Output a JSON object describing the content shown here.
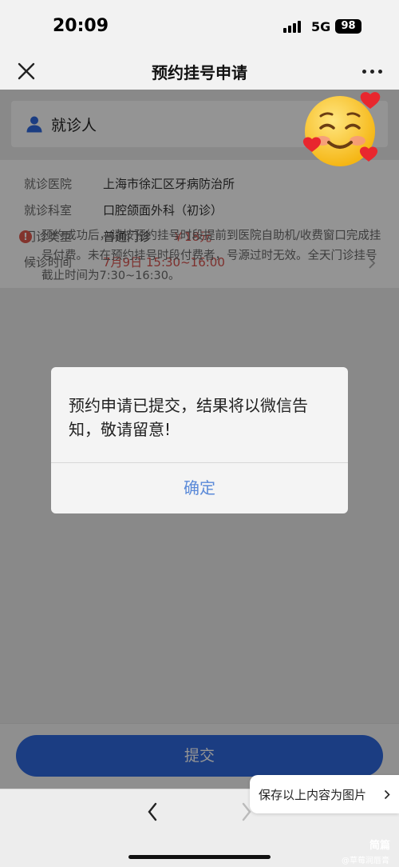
{
  "status_bar": {
    "time": "20:09",
    "network": "5G",
    "battery": "98"
  },
  "nav": {
    "title": "预约挂号申请",
    "close_icon": "close-icon",
    "more_icon": "more-icon"
  },
  "patient": {
    "label": "就诊人",
    "icon": "person-icon"
  },
  "info": {
    "hospital": {
      "label": "就诊医院",
      "value": "上海市徐汇区牙病防治所"
    },
    "department": {
      "label": "就诊科室",
      "value": "口腔颌面外科（初诊）"
    },
    "clinic_type": {
      "label": "门诊类型",
      "value": "普通门诊",
      "fee": "￥18元"
    },
    "wait_time": {
      "label": "候诊时间",
      "value": "7月9日 15:30~16:00"
    }
  },
  "notice": {
    "icon": "alert-icon",
    "text": "预约成功后，请按预约挂号时段提前到医院自助机/收费窗口完成挂号付费。未在预约挂号时段付费者，号源过时无效。全天门诊挂号截止时间为7:30~16:30。"
  },
  "dialog": {
    "message": "预约申请已提交，结果将以微信告知，敬请留意!",
    "confirm": "确定"
  },
  "submit": {
    "label": "提交"
  },
  "save_tooltip": {
    "label": "保存以上内容为图片"
  },
  "watermark": {
    "brand": "简篇",
    "user": "@草莓润唇膏"
  },
  "colors": {
    "accent": "#2f6ae0",
    "fee": "#d9534f",
    "dialog_button": "#5b8ad8"
  }
}
